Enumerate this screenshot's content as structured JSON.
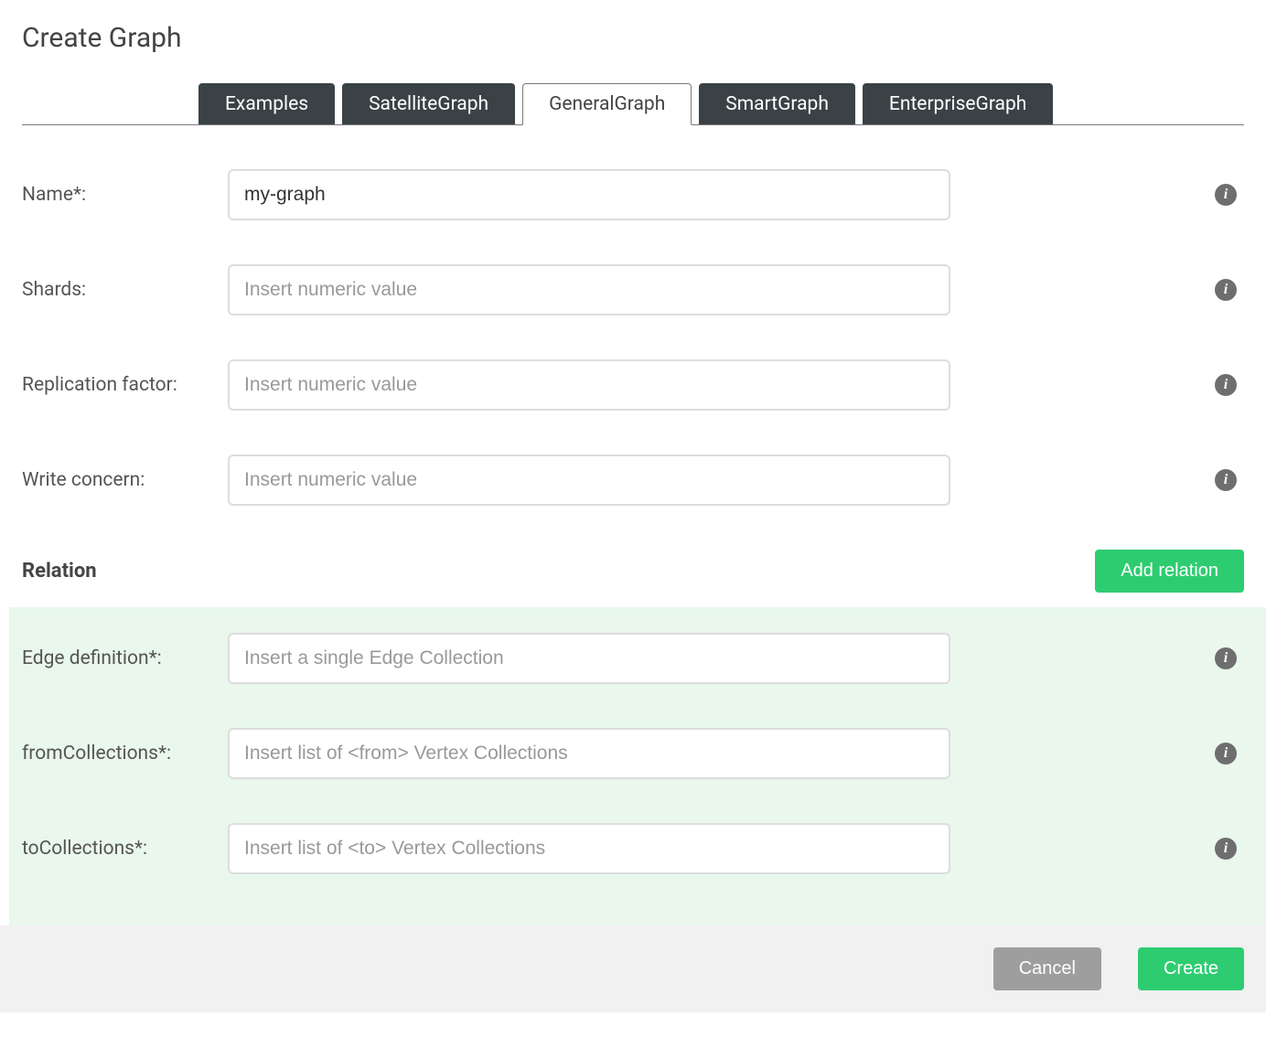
{
  "header": {
    "title": "Create Graph"
  },
  "tabs": [
    {
      "label": "Examples",
      "active": false
    },
    {
      "label": "SatelliteGraph",
      "active": false
    },
    {
      "label": "GeneralGraph",
      "active": true
    },
    {
      "label": "SmartGraph",
      "active": false
    },
    {
      "label": "EnterpriseGraph",
      "active": false
    }
  ],
  "fields": {
    "name": {
      "label": "Name*:",
      "value": "my-graph",
      "placeholder": ""
    },
    "shards": {
      "label": "Shards:",
      "value": "",
      "placeholder": "Insert numeric value"
    },
    "replication": {
      "label": "Replication factor:",
      "value": "",
      "placeholder": "Insert numeric value"
    },
    "writeConcern": {
      "label": "Write concern:",
      "value": "",
      "placeholder": "Insert numeric value"
    }
  },
  "relation": {
    "title": "Relation",
    "addButton": "Add relation",
    "edgeDefinition": {
      "label": "Edge definition*:",
      "value": "",
      "placeholder": "Insert a single Edge Collection"
    },
    "fromCollections": {
      "label": "fromCollections*:",
      "value": "",
      "placeholder": "Insert list of <from> Vertex Collections"
    },
    "toCollections": {
      "label": "toCollections*:",
      "value": "",
      "placeholder": "Insert list of <to> Vertex Collections"
    }
  },
  "footer": {
    "cancel": "Cancel",
    "create": "Create"
  },
  "icons": {
    "info": "i"
  }
}
